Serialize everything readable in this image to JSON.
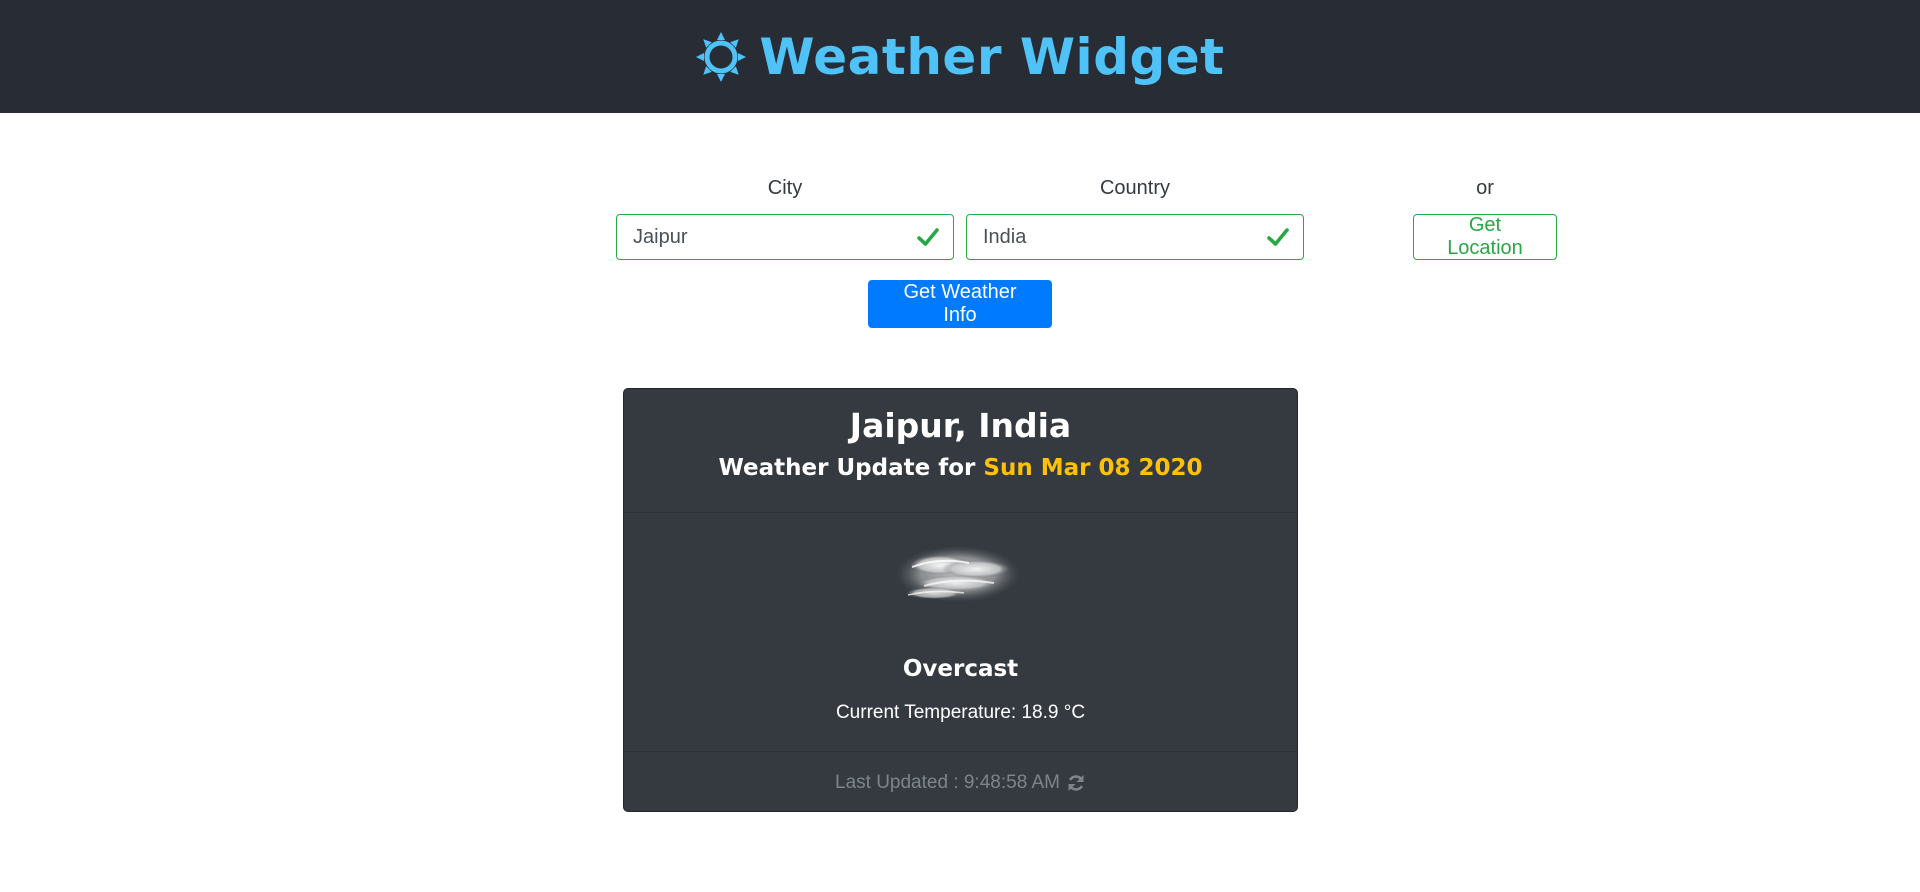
{
  "header": {
    "title": "Weather Widget",
    "icon": "sun-icon",
    "color": "#4fc3f7",
    "background": "#282c34"
  },
  "form": {
    "city": {
      "label": "City",
      "value": "Jaipur",
      "status_icon": "check-icon"
    },
    "country": {
      "label": "Country",
      "value": "India",
      "status_icon": "check-icon"
    },
    "or_text": "or",
    "location_button": "Get Location",
    "submit_button": "Get Weather Info",
    "valid_color": "#28a745",
    "primary_color": "#007bff"
  },
  "card": {
    "title": "Jaipur, India",
    "subtitle_prefix": "Weather Update for ",
    "date": "Sun Mar 08 2020",
    "date_color": "#ffc107",
    "weather_icon": "overcast-clouds-icon",
    "condition": "Overcast",
    "temperature_text": "Current Temperature: 18.9 °C",
    "last_updated": "Last Updated : 9:48:58 AM",
    "refresh_icon": "refresh-icon",
    "background": "#343a40"
  }
}
